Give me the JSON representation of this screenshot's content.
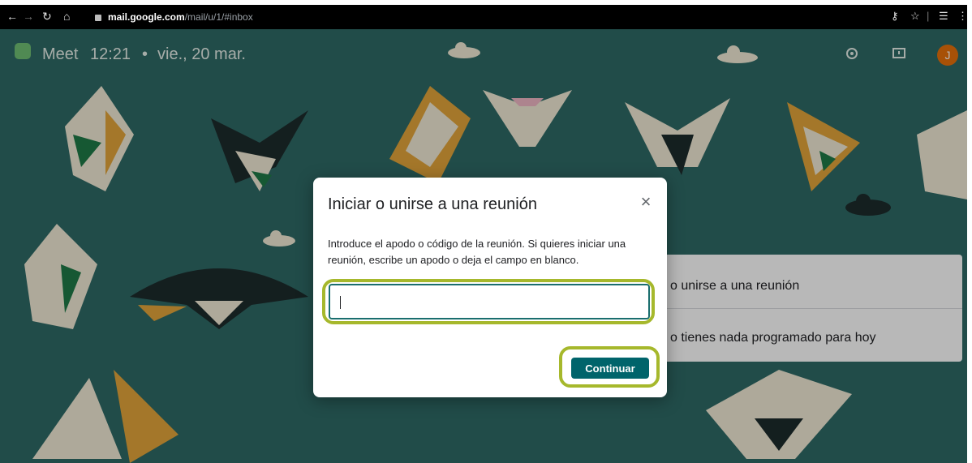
{
  "browser": {
    "url_host": "mail.google.com",
    "url_path": "/mail/u/1/#inbox",
    "icons": [
      "back-arrow-icon",
      "forward-arrow-icon",
      "reload-icon",
      "home-icon",
      "lock-icon",
      "key-icon",
      "star-icon",
      "playlist-icon",
      "menu-icon"
    ]
  },
  "header": {
    "app_name": "Meet",
    "time": "12:21",
    "separator": "•",
    "date": "vie., 20 mar.",
    "icons": [
      "meet-logo-icon",
      "settings-gear-icon",
      "feedback-icon"
    ],
    "avatar_letter": "J",
    "avatar_color": "#e8710a"
  },
  "background_card": {
    "join_text": "o unirse a una reunión",
    "schedule_text": "o tienes nada programado para hoy"
  },
  "dialog": {
    "title": "Iniciar o unirse a una reunión",
    "close_symbol": "×",
    "description": "Introduce el apodo o código de la reunión. Si quieres iniciar una reunión, escribe un apodo o deja el campo en blanco.",
    "input_value": "",
    "continue_label": "Continuar"
  },
  "colors": {
    "page_bg": "#2f6a66",
    "accent": "#00646b",
    "highlight": "#a6b82c"
  }
}
